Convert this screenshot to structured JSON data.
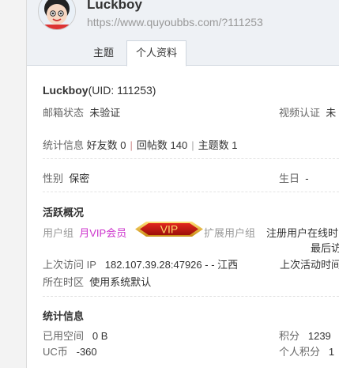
{
  "header": {
    "username": "Luckboy",
    "url": "https://www.quyoubbs.com/?111253",
    "tabs": [
      {
        "label": "主题"
      },
      {
        "label": "个人资料"
      }
    ]
  },
  "profile": {
    "name": "Luckboy",
    "uid": "(UID: 111253)",
    "email_label": "邮箱状态",
    "email_value": "未验证",
    "video_label": "视频认证",
    "video_value": "未",
    "stats_label": "统计信息",
    "friends": "好友数 0",
    "replies": "回帖数 140",
    "topics": "主题数 1",
    "gender_label": "性别",
    "gender_value": "保密",
    "birthday_label": "生日",
    "birthday_value": "-"
  },
  "activity": {
    "title": "活跃概况",
    "group_label": "用户组",
    "group_value": "月VIP会员",
    "vip_badge": "VIP",
    "ext_group_label": "扩展用户组",
    "ext_group_value": "注册用户在线时",
    "last_post_label": "最后访",
    "last_visit_ip_label": "上次访问 IP",
    "last_visit_ip_value": "182.107.39.28:47926 - - 江西",
    "last_activity_label": "上次活动时间",
    "timezone_label": "所在时区",
    "timezone_value": "使用系统默认"
  },
  "stats": {
    "title": "统计信息",
    "space_label": "已用空间",
    "space_value": "0 B",
    "points_label": "积分",
    "points_value": "1239",
    "uc_label": "UC币",
    "uc_value": "-360",
    "personal_points_label": "个人积分",
    "personal_points_value": "1"
  },
  "colors": {
    "vip_link": "#cc33cc",
    "header_bg": "#eef1f5"
  }
}
